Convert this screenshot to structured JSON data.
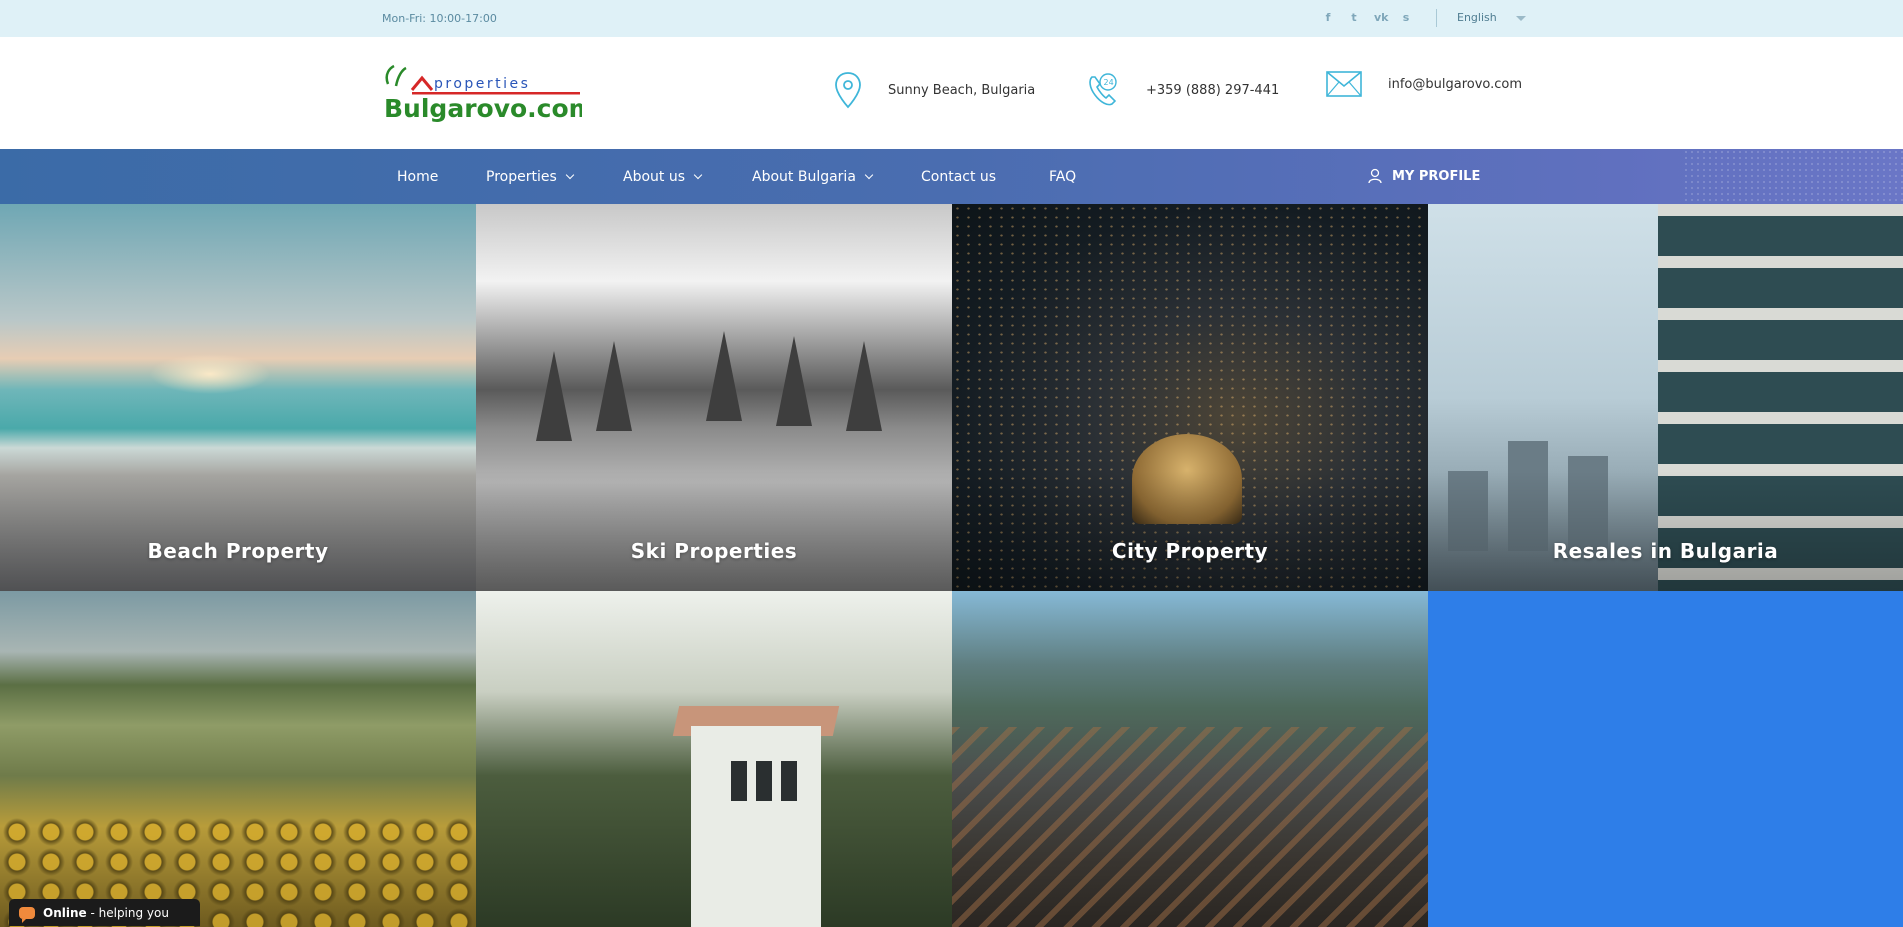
{
  "topbar": {
    "hours": "Mon-Fri: 10:00-17:00",
    "socials": [
      {
        "icon": "facebook-icon",
        "glyph": "f"
      },
      {
        "icon": "twitter-icon",
        "glyph": "t"
      },
      {
        "icon": "vk-icon",
        "glyph": "vk"
      },
      {
        "icon": "skype-icon",
        "glyph": "s"
      }
    ],
    "language": "English"
  },
  "header": {
    "logo": {
      "top": "properties",
      "bottom": "Bulgarovo.com"
    },
    "location": "Sunny Beach, Bulgaria",
    "phone": "+359 (888) 297-441",
    "email": "info@bulgarovo.com"
  },
  "nav": {
    "items": [
      {
        "label": "Home",
        "dropdown": false
      },
      {
        "label": "Properties",
        "dropdown": true
      },
      {
        "label": "About us",
        "dropdown": true
      },
      {
        "label": "About Bulgaria",
        "dropdown": true
      },
      {
        "label": "Contact us",
        "dropdown": false
      },
      {
        "label": "FAQ",
        "dropdown": false
      }
    ],
    "profile": "MY PROFILE"
  },
  "tiles": [
    {
      "label": "Beach Property"
    },
    {
      "label": "Ski Properties"
    },
    {
      "label": "City Property"
    },
    {
      "label": "Resales in Bulgaria"
    }
  ],
  "chat": {
    "status": "Online",
    "text": " - helping you"
  },
  "colors": {
    "topbar_bg": "#dff1f7",
    "nav_start": "#3b6ba7",
    "nav_end": "#6a76c6",
    "accent_icon": "#3fb6d9",
    "blue_tile": "#2e7ee8",
    "logo_green": "#2a8a2a",
    "logo_red": "#d62828"
  }
}
